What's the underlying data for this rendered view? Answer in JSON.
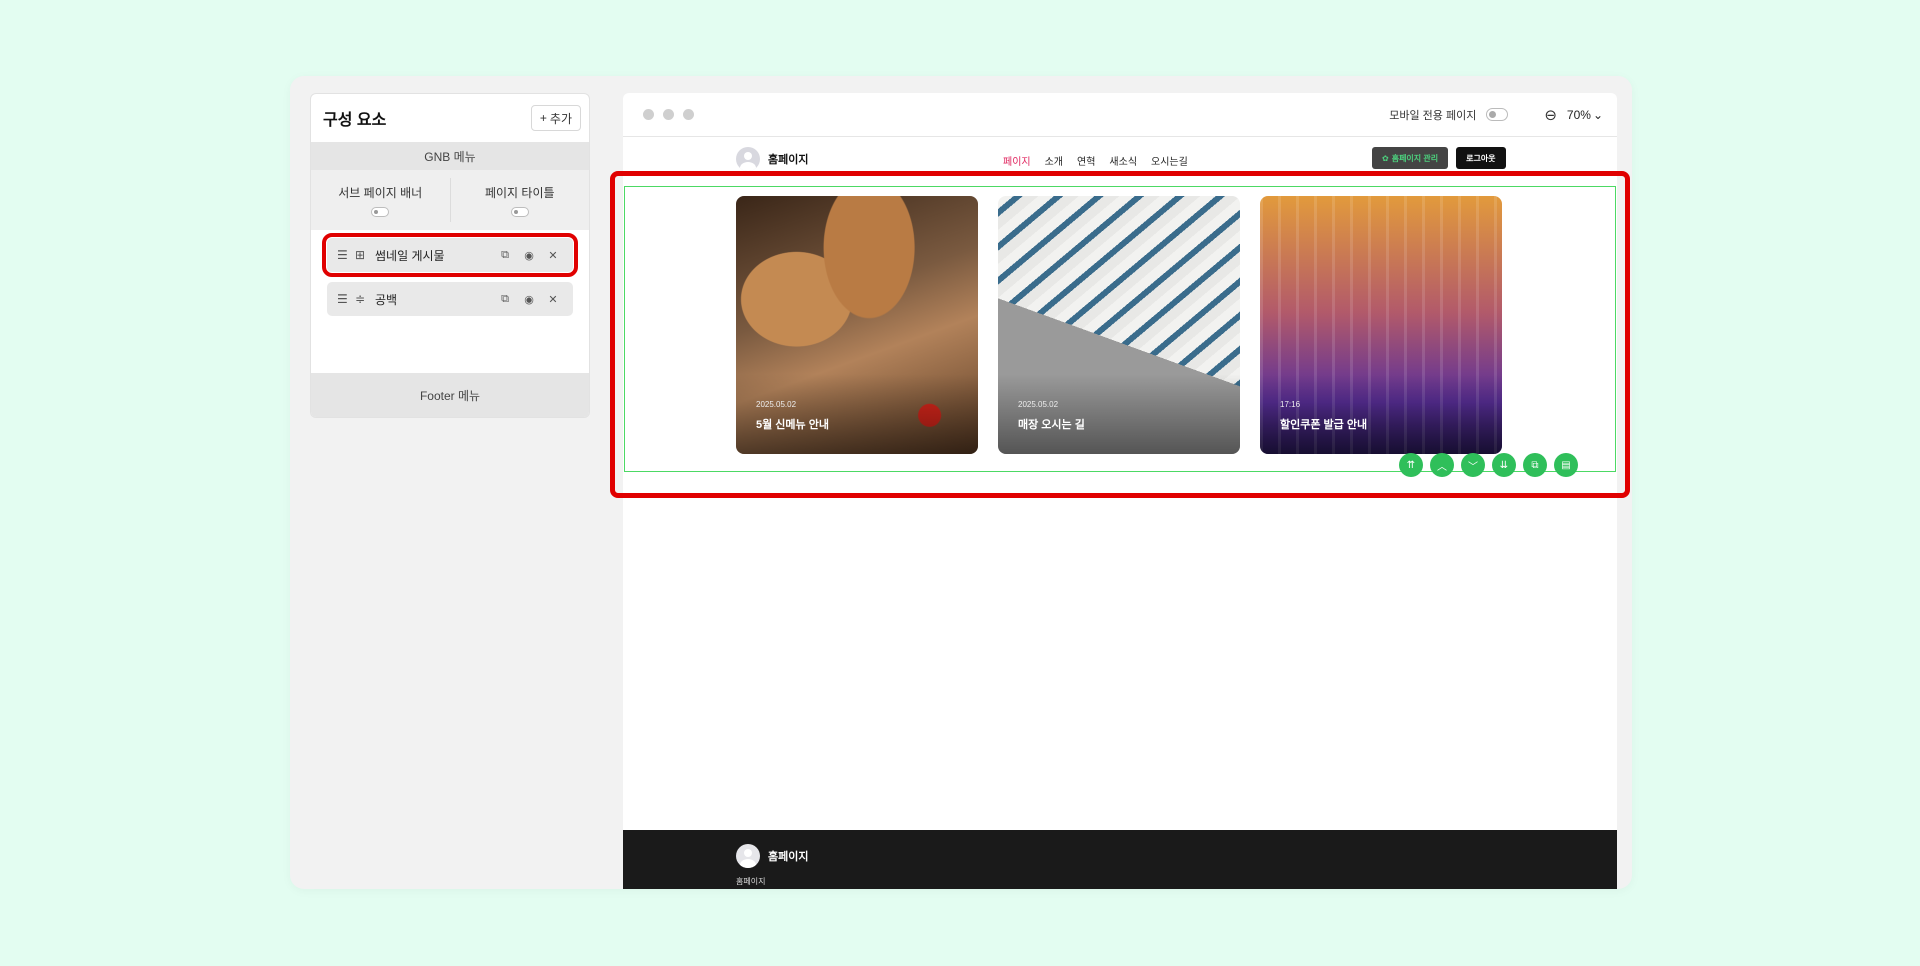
{
  "panel": {
    "title": "구성 요소",
    "add_label": "추가",
    "gnb_label": "GNB 메뉴",
    "toggles": [
      {
        "label": "서브 페이지 배너"
      },
      {
        "label": "페이지 타이틀"
      }
    ],
    "items": [
      {
        "label": "썸네일 게시물",
        "type_icon": "grid-icon",
        "selected": true
      },
      {
        "label": "공백",
        "type_icon": "spacer-icon",
        "selected": false
      }
    ],
    "footer_label": "Footer 메뉴"
  },
  "preview": {
    "mobile_label": "모바일 전용 페이지",
    "zoom": "70%",
    "site": {
      "name": "홈페이지",
      "nav": [
        {
          "label": "페이지",
          "active": true
        },
        {
          "label": "소개",
          "active": false
        },
        {
          "label": "연혁",
          "active": false
        },
        {
          "label": "새소식",
          "active": false
        },
        {
          "label": "오시는길",
          "active": false
        }
      ],
      "admin_label": "홈페이지 관리",
      "logout_label": "로그아웃"
    },
    "cards": [
      {
        "date": "2025.05.02",
        "title": "5월 신메뉴 안내"
      },
      {
        "date": "2025.05.02",
        "title": "매장 오시는 길"
      },
      {
        "date": "17:16",
        "title": "할인쿠폰 발급 안내"
      }
    ],
    "tools": [
      "chevrons-up-icon",
      "chevron-up-icon",
      "chevron-down-icon",
      "chevrons-down-icon",
      "copy-icon",
      "trash-icon"
    ],
    "footer": {
      "name": "홈페이지",
      "sub": "홈페이지"
    }
  },
  "colors": {
    "accent": "#e0245e",
    "green": "#2fbf5a",
    "highlight": "#e00000"
  }
}
